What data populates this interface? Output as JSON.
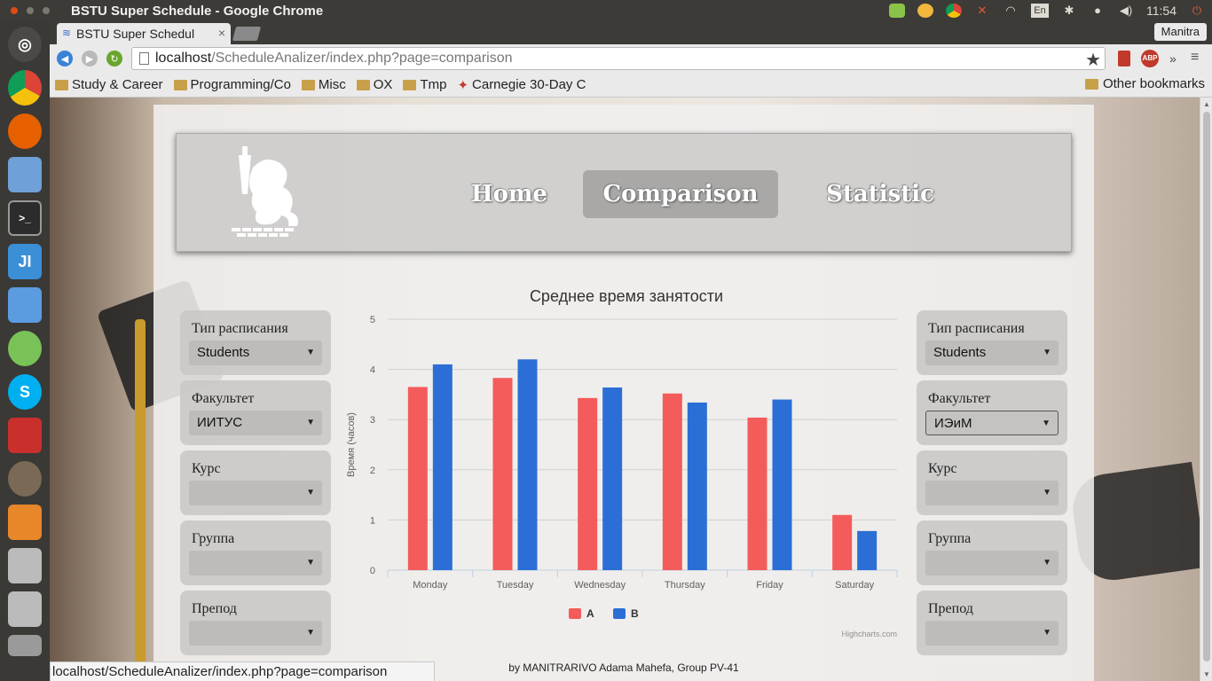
{
  "os": {
    "window_title": "BSTU Super Schedule - Google Chrome",
    "clock": "11:54",
    "keyboard_layout": "En"
  },
  "browser": {
    "tab_title": "BSTU Super Schedul",
    "profile": "Manitra",
    "url_host": "localhost",
    "url_path": "/ScheduleAnalizer/index.php?page=comparison",
    "bookmarks": [
      "Study & Career",
      "Programming/Co",
      "Misc",
      "OX",
      "Tmp",
      "Carnegie 30-Day C"
    ],
    "other_bookmarks": "Other bookmarks",
    "status_url": "localhost/ScheduleAnalizer/index.php?page=comparison"
  },
  "nav": {
    "home": "Home",
    "comparison": "Comparison",
    "statistic": "Statistic"
  },
  "filters_left": [
    {
      "label": "Тип расписания",
      "value": "Students"
    },
    {
      "label": "Факультет",
      "value": "ИИТУС"
    },
    {
      "label": "Курс",
      "value": ""
    },
    {
      "label": "Группа",
      "value": ""
    },
    {
      "label": "Препод",
      "value": ""
    }
  ],
  "filters_right": [
    {
      "label": "Тип расписания",
      "value": "Students"
    },
    {
      "label": "Факультет",
      "value": "ИЭиМ"
    },
    {
      "label": "Курс",
      "value": ""
    },
    {
      "label": "Группа",
      "value": ""
    },
    {
      "label": "Препод",
      "value": ""
    }
  ],
  "chart_data": {
    "type": "bar",
    "title": "Среднее время занятости",
    "xlabel": "",
    "ylabel": "Время (часов)",
    "ylim": [
      0,
      5
    ],
    "yticks": [
      0,
      1,
      2,
      3,
      4,
      5
    ],
    "categories": [
      "Monday",
      "Tuesday",
      "Wednesday",
      "Thursday",
      "Friday",
      "Saturday"
    ],
    "series": [
      {
        "name": "A",
        "color": "#f45b5b",
        "values": [
          3.65,
          3.83,
          3.43,
          3.52,
          3.04,
          1.1
        ]
      },
      {
        "name": "B",
        "color": "#2b6fd6",
        "values": [
          4.1,
          4.2,
          3.64,
          3.34,
          3.4,
          0.78
        ]
      }
    ],
    "grid": true,
    "legend_position": "bottom-center"
  },
  "chart_credits": "Highcharts.com",
  "footer": "by MANITRARIVO Adama Mahefa, Group PV-41"
}
